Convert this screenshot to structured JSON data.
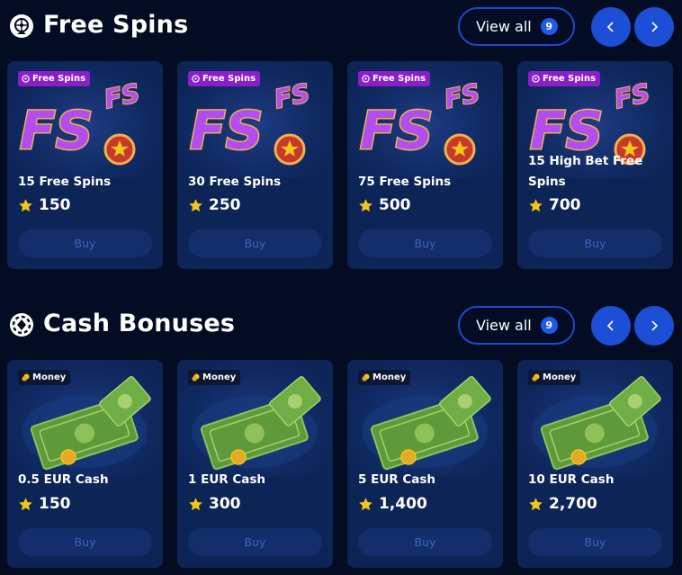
{
  "sections": [
    {
      "title": "Free Spins",
      "icon": "wheel-icon",
      "view_all_label": "View all",
      "view_all_count": "9",
      "cards": [
        {
          "badge": "Free Spins",
          "title": "15 Free Spins",
          "price": "150",
          "buy_label": "Buy",
          "art": "fs-logo"
        },
        {
          "badge": "Free Spins",
          "title": "30 Free Spins",
          "price": "250",
          "buy_label": "Buy",
          "art": "fs-logo"
        },
        {
          "badge": "Free Spins",
          "title": "75 Free Spins",
          "price": "500",
          "buy_label": "Buy",
          "art": "fs-logo"
        },
        {
          "badge": "Free Spins",
          "title": "15 High Bet Free Spins",
          "price": "700",
          "buy_label": "Buy",
          "art": "fs-logo"
        }
      ]
    },
    {
      "title": "Cash Bonuses",
      "icon": "chip-icon",
      "view_all_label": "View all",
      "view_all_count": "9",
      "cards": [
        {
          "badge": "Money",
          "title": "0.5 EUR Cash",
          "price": "150",
          "buy_label": "Buy",
          "art": "cash-stack"
        },
        {
          "badge": "Money",
          "title": "1 EUR Cash",
          "price": "300",
          "buy_label": "Buy",
          "art": "cash-stack"
        },
        {
          "badge": "Money",
          "title": "5 EUR Cash",
          "price": "1,400",
          "buy_label": "Buy",
          "art": "cash-stack"
        },
        {
          "badge": "Money",
          "title": "10 EUR Cash",
          "price": "2,700",
          "buy_label": "Buy",
          "art": "cash-stack"
        }
      ]
    }
  ],
  "colors": {
    "background": "#030c22",
    "card": "#0c2456",
    "accent": "#1c4fd6",
    "free_spins_badge": "#8a1fc9",
    "star": "#f5c518",
    "buy_text": "#3d63b8"
  }
}
